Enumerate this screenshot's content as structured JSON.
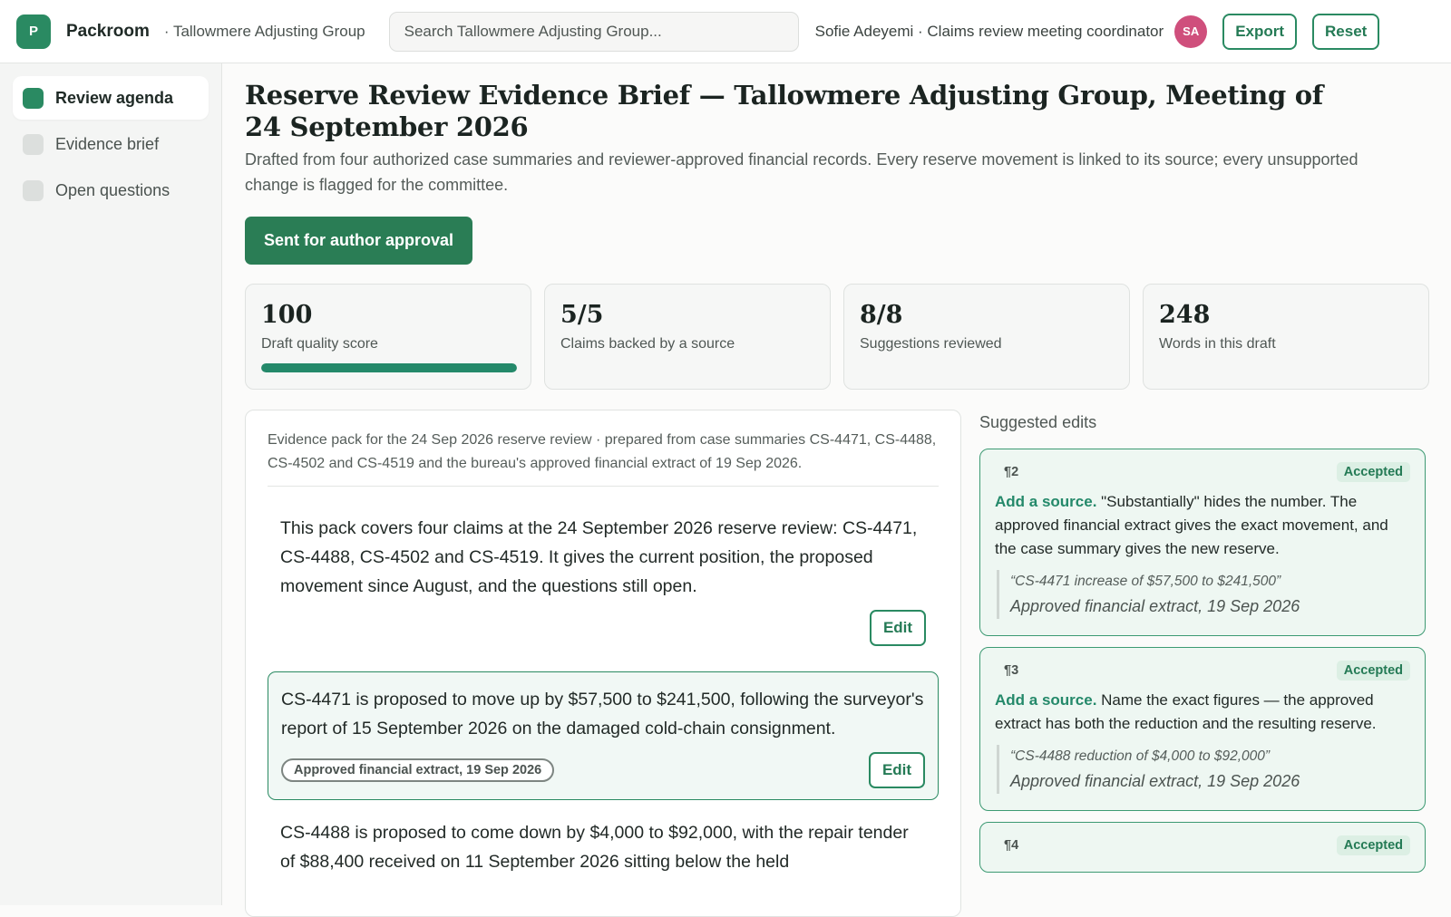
{
  "topbar": {
    "logo_letter": "P",
    "app_name": "Packroom",
    "org": "· Tallowmere Adjusting Group",
    "search_placeholder": "Search Tallowmere Adjusting Group...",
    "user": "Sofie Adeyemi · Claims review meeting coordinator",
    "avatar_initials": "SA",
    "export_label": "Export",
    "reset_label": "Reset"
  },
  "sidebar": {
    "items": [
      {
        "label": "Review agenda",
        "active": true
      },
      {
        "label": "Evidence brief",
        "active": false
      },
      {
        "label": "Open questions",
        "active": false
      }
    ]
  },
  "main": {
    "title": "Reserve Review Evidence Brief — Tallowmere Adjusting Group, Meeting of 24 September 2026",
    "subtitle": "Drafted from four authorized case summaries and reviewer-approved financial records. Every reserve movement is linked to its source; every unsupported change is flagged for the committee.",
    "status_button": "Sent for author approval",
    "stats": [
      {
        "value": "100",
        "label": "Draft quality score",
        "progress": 1.0
      },
      {
        "value": "5/5",
        "label": "Claims backed by a source"
      },
      {
        "value": "8/8",
        "label": "Suggestions reviewed"
      },
      {
        "value": "248",
        "label": "Words in this draft"
      }
    ]
  },
  "doc": {
    "intro": "Evidence pack for the 24 Sep 2026 reserve review · prepared from case summaries CS-4471, CS-4488, CS-4502 and CS-4519 and the bureau's approved financial extract of 19 Sep 2026.",
    "edit_label": "Edit",
    "paragraphs": [
      {
        "text": "This pack covers four claims at the 24 September 2026 reserve review: CS-4471, CS-4488, CS-4502 and CS-4519. It gives the current position, the proposed movement since August, and the questions still open.",
        "source": ""
      },
      {
        "text": "CS-4471 is proposed to move up by $57,500 to $241,500, following the surveyor's report of 15 September 2026 on the damaged cold-chain consignment.",
        "source": "Approved financial extract, 19 Sep 2026"
      },
      {
        "text": "CS-4488 is proposed to come down by $4,000 to $92,000, with the repair tender of $88,400 received on 11 September 2026 sitting below the held",
        "source": ""
      }
    ]
  },
  "suggestions": {
    "heading": "Suggested edits",
    "cards": [
      {
        "ref": "¶2",
        "status": "Accepted",
        "lead": "Add a source.",
        "body": " \"Substantially\" hides the number. The approved financial extract gives the exact movement, and the case summary gives the new reserve.",
        "quote": "“CS-4471 increase of $57,500 to $241,500”",
        "quote_source": "Approved financial extract, 19 Sep 2026"
      },
      {
        "ref": "¶3",
        "status": "Accepted",
        "lead": "Add a source.",
        "body": " Name the exact figures — the approved extract has both the reduction and the resulting reserve.",
        "quote": "“CS-4488 reduction of $4,000 to $92,000”",
        "quote_source": "Approved financial extract, 19 Sep 2026"
      },
      {
        "ref": "¶4",
        "status": "Accepted"
      }
    ]
  },
  "colors": {
    "accent": "#2a8a62",
    "primary_button": "#2a7d55",
    "avatar": "#cf4f7c"
  }
}
